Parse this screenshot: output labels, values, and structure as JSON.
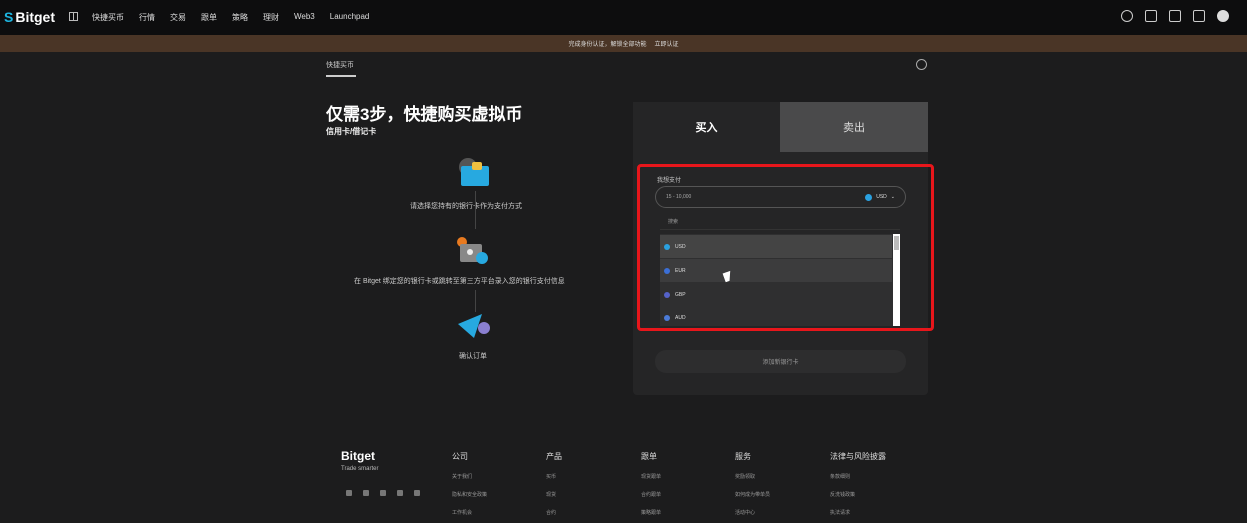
{
  "nav": {
    "logo": "Bitget",
    "items": [
      "快捷买币",
      "行情",
      "交易",
      "跟单",
      "策略",
      "理财",
      "Web3",
      "Launchpad"
    ]
  },
  "banner": {
    "text": "完成身份认证，解锁全部功能",
    "link": "立即认证"
  },
  "page_tab": "快捷买币",
  "headline": "仅需3步，快捷购买虚拟币",
  "subheadline": "信用卡/借记卡",
  "steps": [
    {
      "text": "请选择您持有的银行卡作为支付方式"
    },
    {
      "text": "在 Bitget 绑定您的银行卡或跳转至第三方平台录入您的银行支付信息"
    },
    {
      "text": "确认订单"
    }
  ],
  "trade": {
    "buy_tab": "买入",
    "sell_tab": "卖出",
    "pay_label": "我想支付",
    "amount_placeholder": "15 - 10,000",
    "currency": "USD",
    "search_placeholder": "搜索",
    "options": [
      {
        "code": "USD",
        "color": "#2aa1e0"
      },
      {
        "code": "EUR",
        "color": "#3b6fd6"
      },
      {
        "code": "GBP",
        "color": "#5562c9"
      },
      {
        "code": "AUD",
        "color": "#4b7bd8"
      }
    ],
    "add_card": "添加新银行卡"
  },
  "footer": {
    "logo": "Bitget",
    "slogan": "Trade smarter",
    "columns": [
      {
        "title": "公司",
        "items": [
          "关于我们",
          "隐私和安全政策",
          "工作机会"
        ]
      },
      {
        "title": "产品",
        "items": [
          "买币",
          "现货",
          "合约"
        ]
      },
      {
        "title": "跟单",
        "items": [
          "现货跟单",
          "合约跟单",
          "策略跟单"
        ]
      },
      {
        "title": "服务",
        "items": [
          "奖励领取",
          "如何成为带单员",
          "活动中心"
        ]
      },
      {
        "title": "法律与风险披露",
        "items": [
          "条款细则",
          "反洗钱政策",
          "执法请求"
        ]
      }
    ]
  }
}
